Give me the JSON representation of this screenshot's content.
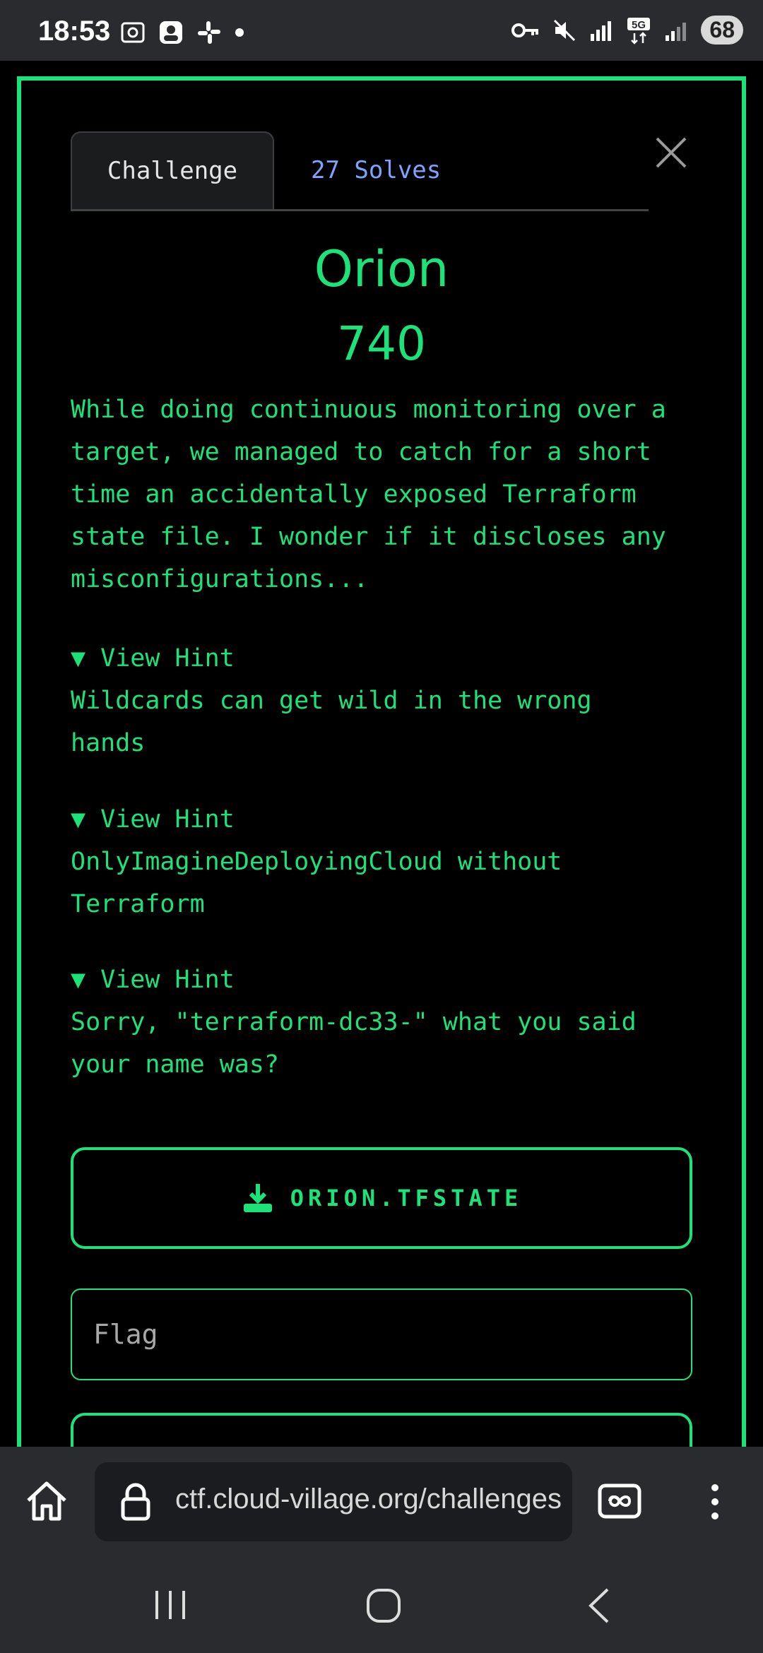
{
  "status_bar": {
    "time": "18:53",
    "battery": "68",
    "network": "5G",
    "left_icons": [
      "screenshot-icon",
      "photo-icon",
      "slack-icon",
      "dot-icon"
    ],
    "right_icons": [
      "vpn-key-icon",
      "mute-icon",
      "signal-r-icon",
      "5g-icon",
      "signal-icon"
    ]
  },
  "tabs": {
    "challenge": "Challenge",
    "solves": "27 Solves"
  },
  "challenge": {
    "name": "Orion",
    "points": "740",
    "description": "While doing continuous monitoring over a\ntarget, we managed to catch for a short\ntime an accidentally exposed Terraform\nstate file. I wonder if it discloses any\nmisconfigurations..."
  },
  "hints": [
    {
      "summary": "▼ View Hint",
      "text": "Wildcards can get wild in the wrong\nhands"
    },
    {
      "summary": "▼ View Hint",
      "text": "OnlyImagineDeployingCloud without\nTerraform"
    },
    {
      "summary": "▼ View Hint",
      "text": "Sorry, \"terraform-dc33-\" what you said\nyour name was?"
    }
  ],
  "download": {
    "label": "ORION.TFSTATE"
  },
  "flag_input": {
    "placeholder": "Flag",
    "value": ""
  },
  "browser": {
    "url": "ctf.cloud-village.org/challenges"
  },
  "colors": {
    "accent": "#1be37a",
    "solves": "#7ea3ff",
    "chrome": "#2a2b2f"
  }
}
